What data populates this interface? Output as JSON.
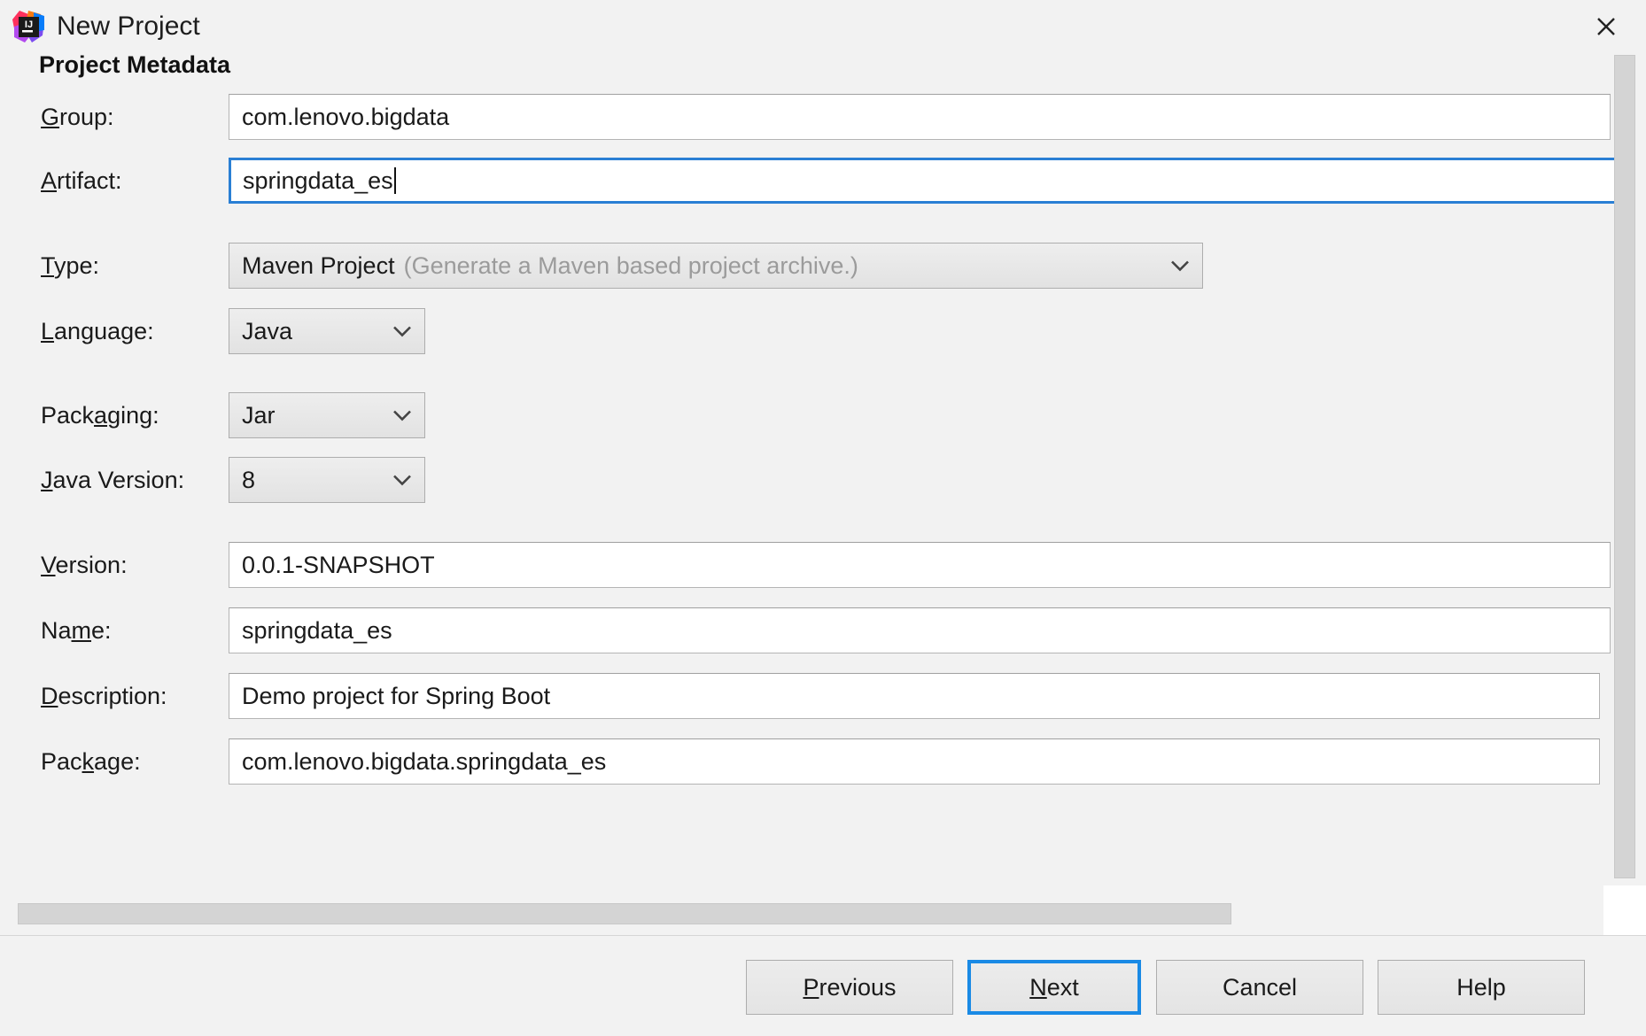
{
  "window": {
    "title": "New Project",
    "app_icon": "intellij-idea-icon",
    "close_icon": "close-icon"
  },
  "step": {
    "heading": "Project Metadata"
  },
  "form": {
    "fields": [
      {
        "key": "group",
        "label": "Group:",
        "mnemonic": "G",
        "control": "text",
        "value": "com.lenovo.bigdata",
        "focused": false
      },
      {
        "key": "artifact",
        "label": "Artifact:",
        "mnemonic": "A",
        "control": "text",
        "value": "springdata_es",
        "focused": true
      },
      {
        "key": "type",
        "label": "Type:",
        "mnemonic": "T",
        "control": "combo",
        "value": "Maven Project",
        "hint": "(Generate a Maven based project archive.)",
        "focused": false
      },
      {
        "key": "language",
        "label": "Language:",
        "mnemonic": "L",
        "control": "combo",
        "value": "Java",
        "hint": "",
        "focused": false
      },
      {
        "key": "packaging",
        "label": "Packaging:",
        "mnemonic": "a",
        "control": "combo",
        "value": "Jar",
        "hint": "",
        "focused": false
      },
      {
        "key": "java_version",
        "label": "Java Version:",
        "mnemonic": "J",
        "control": "combo",
        "value": "8",
        "hint": "",
        "focused": false
      },
      {
        "key": "version",
        "label": "Version:",
        "mnemonic": "V",
        "control": "text",
        "value": "0.0.1-SNAPSHOT",
        "focused": false
      },
      {
        "key": "name",
        "label": "Name:",
        "mnemonic": "m",
        "control": "text",
        "value": "springdata_es",
        "focused": false
      },
      {
        "key": "description",
        "label": "Description:",
        "mnemonic": "D",
        "control": "text",
        "value": "Demo project for Spring Boot",
        "focused": false
      },
      {
        "key": "package",
        "label": "Package:",
        "mnemonic": "k",
        "control": "text",
        "value": "com.lenovo.bigdata.springdata_es",
        "focused": false
      }
    ]
  },
  "labels": {
    "group_pre": "",
    "group_mn": "G",
    "group_post": "roup:",
    "artifact_pre": "",
    "artifact_mn": "A",
    "artifact_post": "rtifact:",
    "type_pre": "",
    "type_mn": "T",
    "type_post": "ype:",
    "language_pre": "",
    "language_mn": "L",
    "language_post": "anguage:",
    "packaging_pre": "Pack",
    "packaging_mn": "a",
    "packaging_post": "ging:",
    "javaversion_pre": "",
    "javaversion_mn": "J",
    "javaversion_post": "ava Version:",
    "version_pre": "",
    "version_mn": "V",
    "version_post": "ersion:",
    "name_pre": "Na",
    "name_mn": "m",
    "name_post": "e:",
    "description_pre": "",
    "description_mn": "D",
    "description_post": "escription:",
    "package_pre": "Pac",
    "package_mn": "k",
    "package_post": "age:"
  },
  "buttons": {
    "previous": {
      "pre": "",
      "mn": "P",
      "post": "revious",
      "default": false
    },
    "next": {
      "pre": "",
      "mn": "N",
      "post": "ext",
      "default": true
    },
    "cancel": {
      "pre": "Cancel",
      "mn": "",
      "post": "",
      "default": false
    },
    "help": {
      "pre": "Help",
      "mn": "",
      "post": "",
      "default": false
    }
  },
  "scrollbars": {
    "vertical_icon": "vertical-scrollbar",
    "horizontal_icon": "horizontal-scrollbar"
  },
  "colors": {
    "dialog_bg": "#f2f2f2",
    "field_bg": "#ffffff",
    "focus_blue": "#2a7fd4",
    "default_button_blue": "#1a8ae5",
    "hint_grey": "#9b9b9b",
    "border_grey": "#adadad"
  }
}
